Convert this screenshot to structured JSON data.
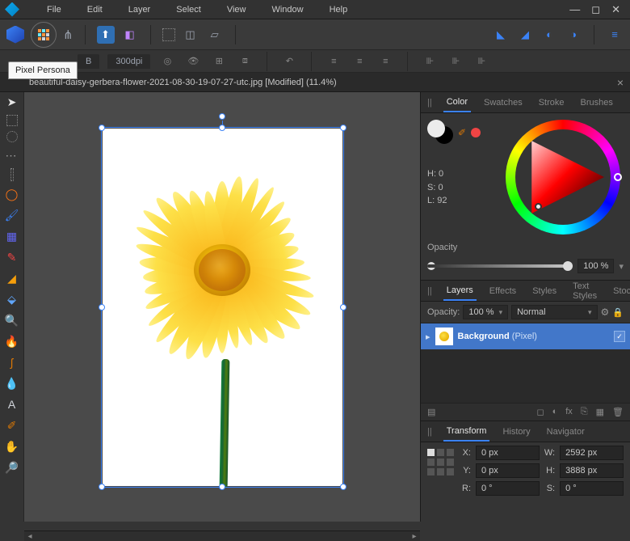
{
  "menu": {
    "items": [
      "File",
      "Edit",
      "Layer",
      "Select",
      "View",
      "Window",
      "Help"
    ]
  },
  "tooltip": "Pixel Persona",
  "tab_b": "B",
  "dpi": "300dpi",
  "doc": {
    "title": "beautiful-daisy-gerbera-flower-2021-08-30-19-07-27-utc.jpg [Modified] (11.4%)"
  },
  "color_tabs": [
    "Color",
    "Swatches",
    "Stroke",
    "Brushes"
  ],
  "hsl": {
    "h": "H: 0",
    "s": "S: 0",
    "l": "L: 92"
  },
  "opacity": {
    "label": "Opacity",
    "value": "100 %"
  },
  "layer_tabs": [
    "Layers",
    "Effects",
    "Styles",
    "Text Styles",
    "Stock"
  ],
  "layer_opts": {
    "opacity_label": "Opacity:",
    "opacity_value": "100 %",
    "blend": "Normal"
  },
  "layer": {
    "name": "Background",
    "type": "(Pixel)"
  },
  "transform_tabs": [
    "Transform",
    "History",
    "Navigator"
  ],
  "transform": {
    "x_l": "X:",
    "x_v": "0 px",
    "y_l": "Y:",
    "y_v": "0 px",
    "w_l": "W:",
    "w_v": "2592 px",
    "h_l": "H:",
    "h_v": "3888 px",
    "r_l": "R:",
    "r_v": "0 °",
    "s_l": "S:",
    "s_v": "0 °"
  }
}
